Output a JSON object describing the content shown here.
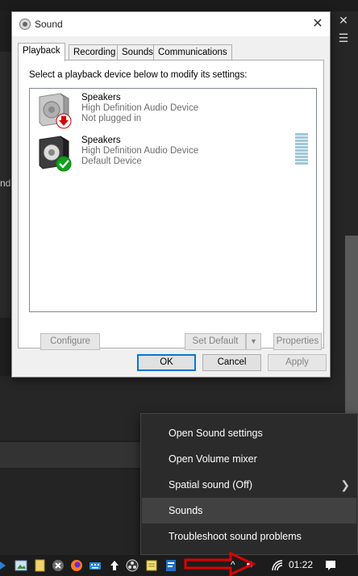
{
  "dialog": {
    "title": "Sound",
    "tabs": [
      {
        "label": "Playback",
        "active": true
      },
      {
        "label": "Recording"
      },
      {
        "label": "Sounds"
      },
      {
        "label": "Communications"
      }
    ],
    "instructions": "Select a playback device below to modify its settings:",
    "devices": [
      {
        "name": "Speakers",
        "description": "High Definition Audio Device",
        "status": "Not plugged in",
        "badge": "red-down-arrow-icon"
      },
      {
        "name": "Speakers",
        "description": "High Definition Audio Device",
        "status": "Default Device",
        "badge": "green-check-icon"
      }
    ],
    "buttons": {
      "configure": "Configure",
      "set_default": "Set Default",
      "properties": "Properties",
      "ok": "OK",
      "cancel": "Cancel",
      "apply": "Apply"
    }
  },
  "background": {
    "left_fragment": "nd"
  },
  "context_menu": {
    "items": [
      {
        "label": "Open Sound settings"
      },
      {
        "label": "Open Volume mixer"
      },
      {
        "label": "Spatial sound (Off)",
        "submenu": true
      },
      {
        "label": "Sounds",
        "highlighted": true
      },
      {
        "label": "Troubleshoot sound problems"
      }
    ]
  },
  "taskbar": {
    "clock": "01:22"
  },
  "colors": {
    "accent": "#0078d7",
    "menu_bg": "#2b2b2b",
    "menu_hover": "#414141",
    "annotation_arrow": "#e00000"
  }
}
